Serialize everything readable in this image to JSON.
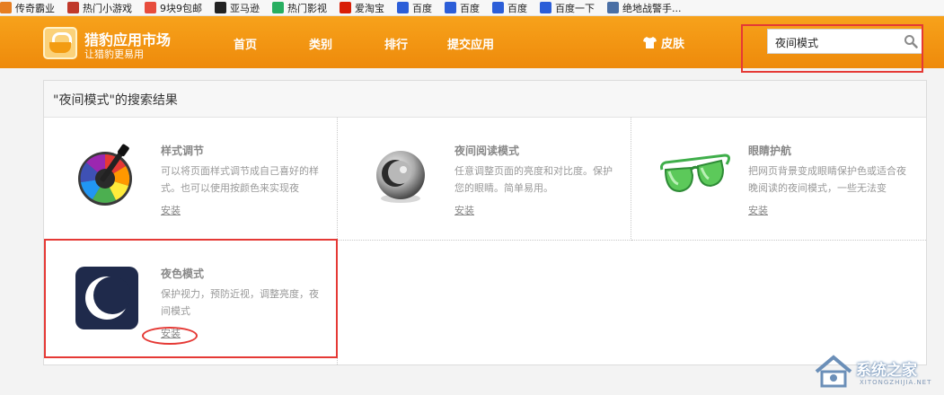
{
  "bookmarks": [
    {
      "label": "传奇霸业",
      "icon": "flame-icon",
      "color": "#e67e22"
    },
    {
      "label": "热门小游戏",
      "icon": "game-icon",
      "color": "#c0392b"
    },
    {
      "label": "9块9包邮",
      "icon": "gift-icon",
      "color": "#e74c3c"
    },
    {
      "label": "亚马逊",
      "icon": "amazon-icon",
      "color": "#222222"
    },
    {
      "label": "热门影视",
      "icon": "play-icon",
      "color": "#27ae60"
    },
    {
      "label": "爱淘宝",
      "icon": "taobao-icon",
      "color": "#d81e06"
    },
    {
      "label": "百度",
      "icon": "paw-icon",
      "color": "#2c5ed8"
    },
    {
      "label": "百度",
      "icon": "paw-icon",
      "color": "#2c5ed8"
    },
    {
      "label": "百度",
      "icon": "paw-icon",
      "color": "#2c5ed8"
    },
    {
      "label": "百度一下",
      "icon": "paw-icon",
      "color": "#2c5ed8"
    },
    {
      "label": "绝地战警手...",
      "icon": "page-icon",
      "color": "#4a6fa5"
    }
  ],
  "header": {
    "title": "猎豹应用市场",
    "subtitle": "让猎豹更易用",
    "nav": [
      "首页",
      "类别",
      "排行",
      "提交应用"
    ],
    "skin_label": "皮肤",
    "search_value": "夜间模式",
    "accent": "#f29a14"
  },
  "results": {
    "title": "\"夜间模式\"的搜索结果",
    "install_label": "安装",
    "apps": [
      {
        "name": "样式调节",
        "desc": "可以将页面样式调节成自己喜好的样式。也可以使用按颜色来实现夜",
        "icon": "color-picker-icon"
      },
      {
        "name": "夜间阅读模式",
        "desc": "任意调整页面的亮度和对比度。保护您的眼睛。简单易用。",
        "icon": "moon-sphere-icon"
      },
      {
        "name": "眼睛护航",
        "desc": "把网页背景变成眼睛保护色或适合夜晚阅读的夜间模式，一些无法变",
        "icon": "sunglasses-icon"
      },
      {
        "name": "夜色模式",
        "desc": "保护视力，预防近视，调整亮度，夜间模式",
        "icon": "crescent-moon-icon"
      }
    ]
  },
  "watermark": {
    "text": "系统之家",
    "sub": "XITONGZHIJIA.NET"
  }
}
